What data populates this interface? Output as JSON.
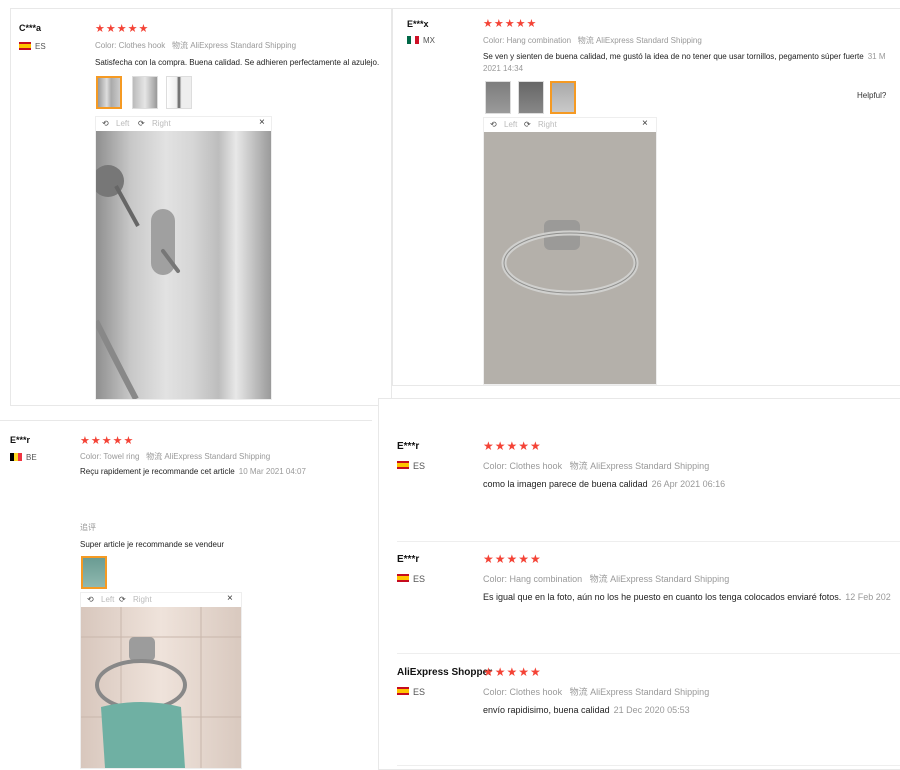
{
  "reviews": [
    {
      "name": "C***a",
      "country": "ES",
      "color_label": "Color:",
      "color": "Clothes hook",
      "ship_label": "物流",
      "shipping": "AliExpress Standard Shipping",
      "text": "Satisfecha con la compra. Buena calidad. Se adhieren perfectamente al azulejo.",
      "date": ""
    },
    {
      "name": "E***x",
      "country": "MX",
      "color_label": "Color:",
      "color": "Hang combination",
      "ship_label": "物流",
      "shipping": "AliExpress Standard Shipping",
      "text": "Se ven y sienten de buena calidad, me gustó la idea de no tener que usar tornillos, pegamento súper fuerte",
      "date": "31 M",
      "date2": "2021 14:34",
      "helpful": "Helpful?"
    },
    {
      "name": "E***r",
      "country": "BE",
      "color_label": "Color:",
      "color": "Towel ring",
      "ship_label": "物流",
      "shipping": "AliExpress Standard Shipping",
      "text": "Reçu rapidement je recommande cet article",
      "date": "10 Mar 2021 04:07",
      "followup_label": "追评",
      "followup": "Super article je recommande se vendeur"
    },
    {
      "name": "E***r",
      "country": "ES",
      "color_label": "Color:",
      "color": "Clothes hook",
      "ship_label": "物流",
      "shipping": "AliExpress Standard Shipping",
      "text": "como la imagen parece de buena calidad",
      "date": "26 Apr 2021 06:16"
    },
    {
      "name": "E***r",
      "country": "ES",
      "color_label": "Color:",
      "color": "Hang combination",
      "ship_label": "物流",
      "shipping": "AliExpress Standard Shipping",
      "text": "Es igual que en la foto, aún no los he puesto en cuanto los tenga colocados enviaré fotos.",
      "date": "12 Feb 202"
    },
    {
      "name": "AliExpress Shopper",
      "country": "ES",
      "color_label": "Color:",
      "color": "Clothes hook",
      "ship_label": "物流",
      "shipping": "AliExpress Standard Shipping",
      "text": "envío rapidisimo, buena calidad",
      "date": "21 Dec 2020 05:53"
    }
  ],
  "stars": "★★★★★",
  "viewer": {
    "left": "Left",
    "right": "Right",
    "close": "×",
    "rotate_left": "⟲",
    "rotate_right": "⟳"
  }
}
